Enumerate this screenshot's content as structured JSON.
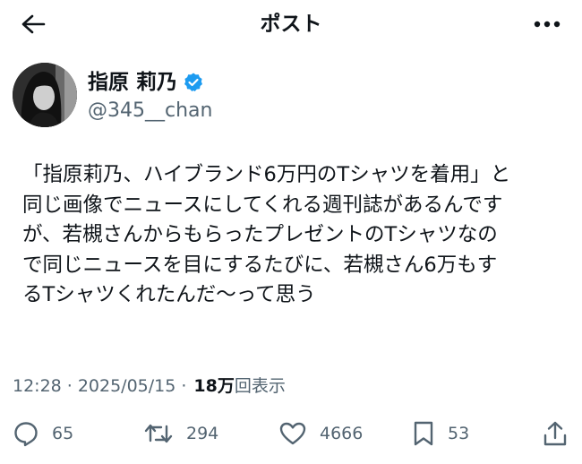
{
  "header": {
    "title": "ポスト",
    "back_icon": "arrow-left-icon",
    "more_icon": "more-horizontal-icon"
  },
  "author": {
    "display_name": "指原 莉乃",
    "handle": "@345__chan",
    "verified_icon": "verified-badge-icon",
    "verified_color": "#1d9bf0"
  },
  "post": {
    "lines": [
      "「指原莉乃、ハイブランド6万円のTシャツを着用」と",
      "同じ画像でニュースにしてくれる週刊誌があるんです",
      "が、若槻さんからもらったプレゼントのTシャツなの",
      "で同じニュースを目にするたびに、若槻さん6万もす",
      "るTシャツくれたんだ〜って思う"
    ]
  },
  "meta": {
    "time": "12:28",
    "separator": "·",
    "date": "2025/05/15",
    "views_count": "18万",
    "views_label": "回表示"
  },
  "actions": {
    "reply": {
      "icon": "reply-icon",
      "count": "65"
    },
    "repost": {
      "icon": "repost-icon",
      "count": "294"
    },
    "like": {
      "icon": "heart-icon",
      "count": "4666"
    },
    "bookmark": {
      "icon": "bookmark-icon",
      "count": "53"
    },
    "share": {
      "icon": "share-icon"
    }
  },
  "colors": {
    "text": "#0f1419",
    "secondary": "#536471",
    "accent": "#1d9bf0",
    "background": "#ffffff"
  }
}
